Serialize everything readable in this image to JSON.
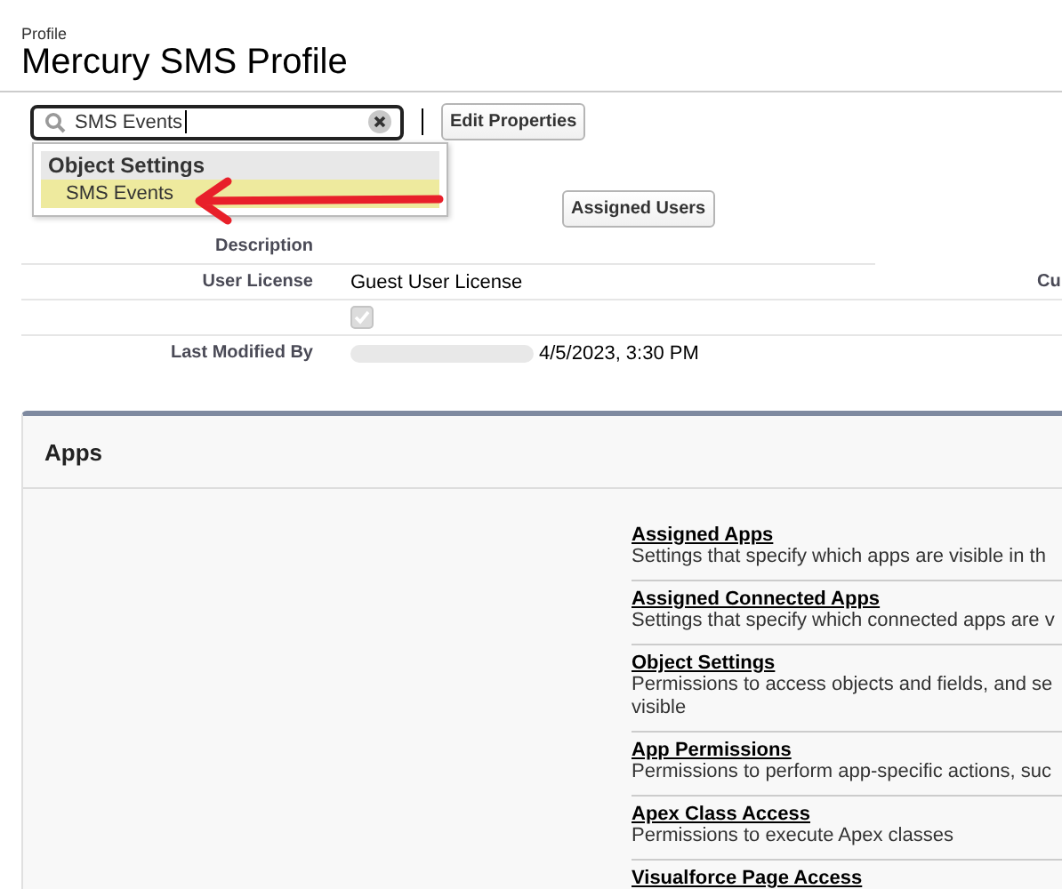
{
  "header": {
    "object_type": "Profile",
    "title": "Mercury SMS Profile"
  },
  "search": {
    "value": "SMS Events"
  },
  "edit_button": "Edit Properties",
  "dropdown": {
    "group": "Object Settings",
    "items": [
      {
        "label": "SMS Events",
        "selected": true
      }
    ]
  },
  "assigned_users_button": "Assigned Users",
  "details": [
    {
      "kind": "text",
      "label": "Description"
    },
    {
      "kind": "text",
      "label": "User License",
      "value": "Guest User License",
      "side_label": "Cu"
    },
    {
      "kind": "checkbox",
      "checked": true,
      "disabled": true
    },
    {
      "kind": "modified",
      "label": "Last Modified By",
      "value": "4/5/2023, 3:30 PM"
    }
  ],
  "apps": {
    "title": "Apps",
    "items": [
      {
        "link": "Assigned Apps",
        "desc": [
          "Settings that specify which apps are visible in th"
        ]
      },
      {
        "link": "Assigned Connected Apps",
        "desc": [
          "Settings that specify which connected apps are v"
        ]
      },
      {
        "link": "Object Settings",
        "desc": [
          "Permissions to access objects and fields, and se",
          "visible"
        ]
      },
      {
        "link": "App Permissions",
        "desc": [
          "Permissions to perform app-specific actions, suc"
        ]
      },
      {
        "link": "Apex Class Access",
        "desc": [
          "Permissions to execute Apex classes"
        ]
      },
      {
        "link": "Visualforce Page Access"
      }
    ]
  }
}
